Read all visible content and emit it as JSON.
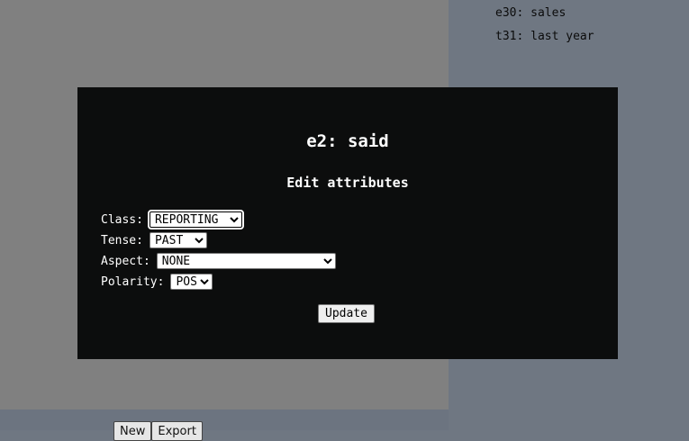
{
  "entities": [
    "e30: sales",
    "t31: last year"
  ],
  "bottom_buttons": {
    "new": "New",
    "export": "Export"
  },
  "modal": {
    "title": "e2: said",
    "subtitle": "Edit attributes",
    "fields": {
      "class": {
        "label": "Class:",
        "value": "REPORTING"
      },
      "tense": {
        "label": "Tense:",
        "value": "PAST"
      },
      "aspect": {
        "label": "Aspect:",
        "value": "NONE"
      },
      "polarity": {
        "label": "Polarity:",
        "value": "POS"
      }
    },
    "update_label": "Update"
  }
}
